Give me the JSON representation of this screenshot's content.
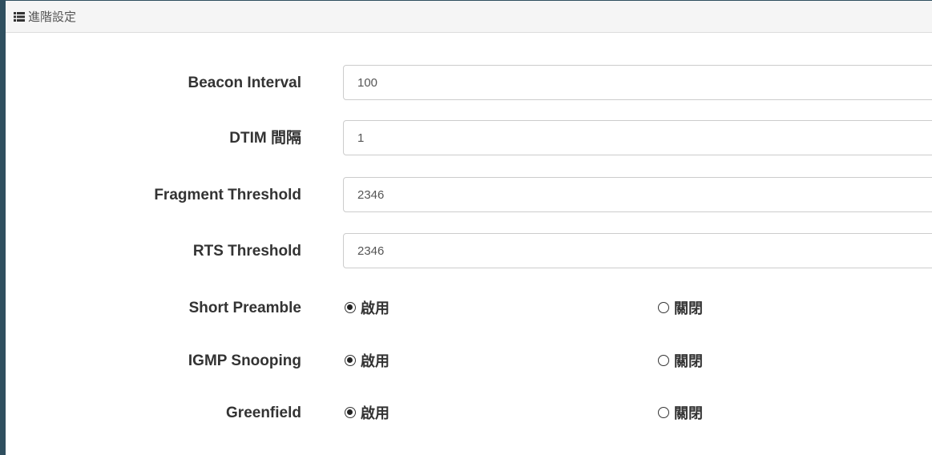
{
  "panel": {
    "title": "進階設定",
    "icon": "list-icon"
  },
  "fields": [
    {
      "label": "Beacon Interval",
      "value": "100"
    },
    {
      "label": "DTIM 間隔",
      "value": "1"
    },
    {
      "label": "Fragment Threshold",
      "value": "2346"
    },
    {
      "label": "RTS Threshold",
      "value": "2346"
    }
  ],
  "radios": [
    {
      "label": "Short Preamble",
      "enable": "啟用",
      "disable": "關閉",
      "selected": "enable"
    },
    {
      "label": "IGMP Snooping",
      "enable": "啟用",
      "disable": "關閉",
      "selected": "enable"
    },
    {
      "label": "Greenfield",
      "enable": "啟用",
      "disable": "關閉",
      "selected": "enable"
    }
  ],
  "colors": {
    "panel_border": "#2f4f5f",
    "heading_bg": "#f5f5f5"
  }
}
